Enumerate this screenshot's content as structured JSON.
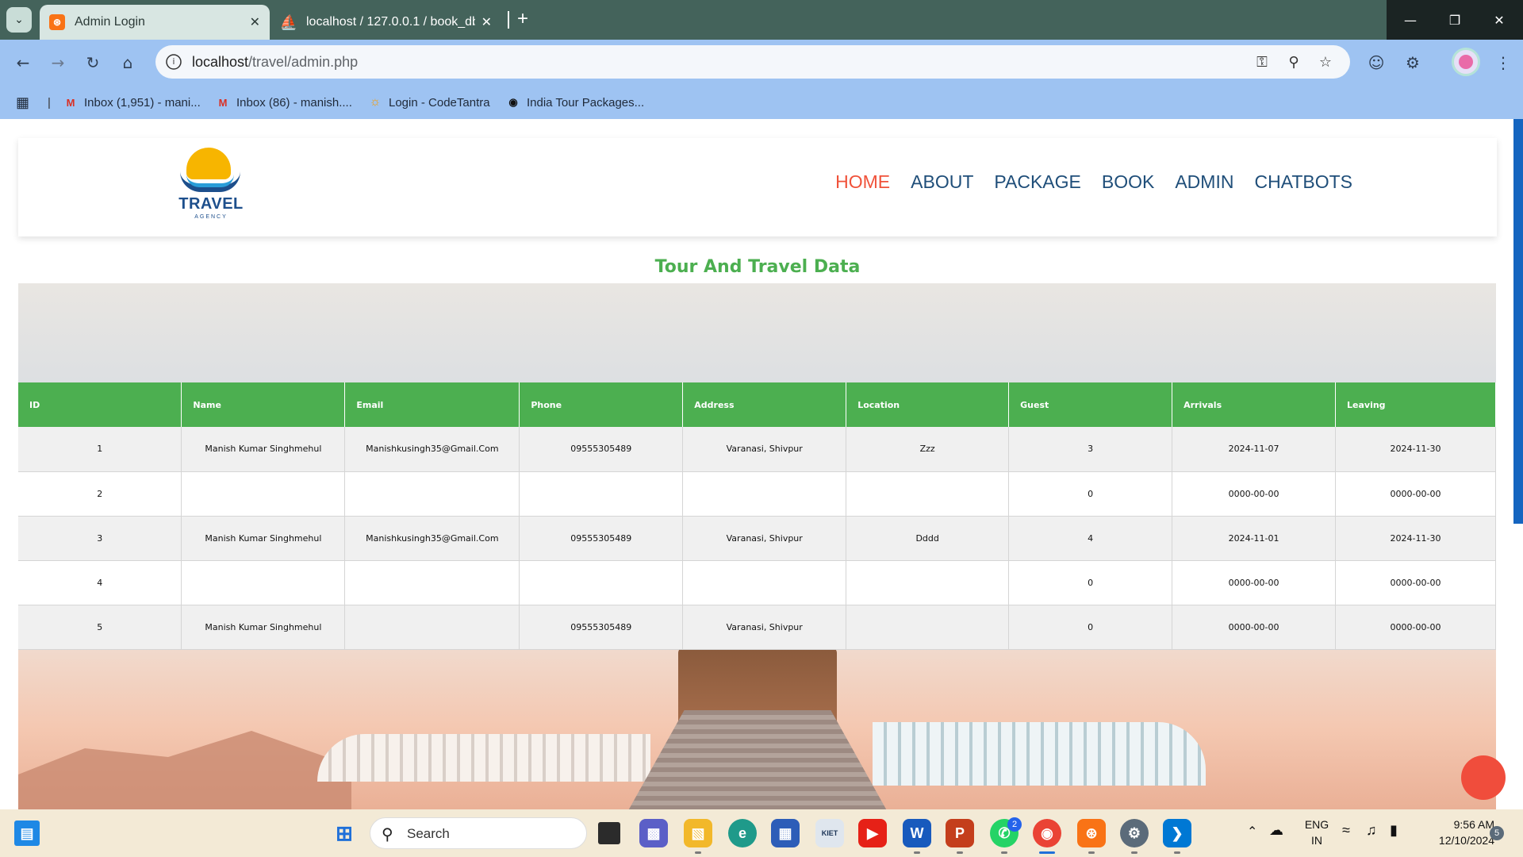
{
  "browser": {
    "tabs": [
      {
        "title": "Admin Login"
      },
      {
        "title": "localhost / 127.0.0.1 / book_db"
      }
    ],
    "url_host": "localhost",
    "url_path": "/travel/admin.php",
    "bookmarks": [
      {
        "label": "Inbox (1,951) - mani..."
      },
      {
        "label": "Inbox (86) - manish...."
      },
      {
        "label": "Login - CodeTantra"
      },
      {
        "label": "India Tour Packages..."
      }
    ]
  },
  "site": {
    "logo_text": "TRAVEL",
    "logo_sub": "AGENCY",
    "nav": [
      "HOME",
      "ABOUT",
      "PACKAGE",
      "BOOK",
      "ADMIN",
      "CHATBOTS"
    ],
    "active_nav": "HOME",
    "section_title": "Tour And Travel Data",
    "accent_color": "#4caf50",
    "active_color": "#f0523a"
  },
  "table": {
    "headers": [
      "ID",
      "Name",
      "Email",
      "Phone",
      "Address",
      "Location",
      "Guest",
      "Arrivals",
      "Leaving"
    ],
    "rows": [
      [
        "1",
        "Manish Kumar Singhmehul",
        "Manishkusingh35@Gmail.Com",
        "09555305489",
        "Varanasi, Shivpur",
        "Zzz",
        "3",
        "2024-11-07",
        "2024-11-30"
      ],
      [
        "2",
        "",
        "",
        "",
        "",
        "",
        "0",
        "0000-00-00",
        "0000-00-00"
      ],
      [
        "3",
        "Manish Kumar Singhmehul",
        "Manishkusingh35@Gmail.Com",
        "09555305489",
        "Varanasi, Shivpur",
        "Dddd",
        "4",
        "2024-11-01",
        "2024-11-30"
      ],
      [
        "4",
        "",
        "",
        "",
        "",
        "",
        "0",
        "0000-00-00",
        "0000-00-00"
      ],
      [
        "5",
        "Manish Kumar Singhmehul",
        "",
        "09555305489",
        "Varanasi, Shivpur",
        "",
        "0",
        "0000-00-00",
        "0000-00-00"
      ]
    ]
  },
  "taskbar": {
    "search_label": "Search",
    "lang_top": "ENG",
    "lang_bottom": "IN",
    "time": "9:56 AM",
    "date": "12/10/2024",
    "whatsapp_badge": "2",
    "notif_count": "5"
  }
}
